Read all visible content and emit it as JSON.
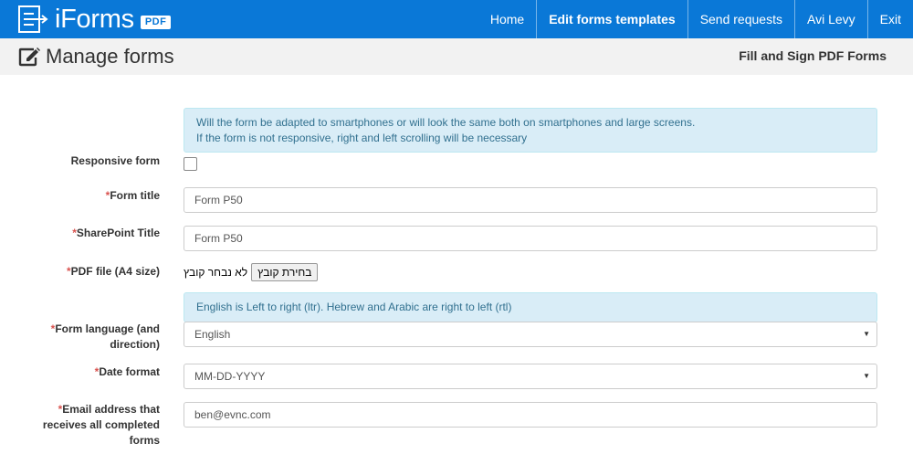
{
  "brand": {
    "name": "iForms",
    "badge": "PDF",
    "logo_icon": "form-arrow-icon"
  },
  "nav": {
    "items": [
      {
        "label": "Home"
      },
      {
        "label": "Edit forms templates"
      },
      {
        "label": "Send requests"
      },
      {
        "label": "Avi Levy"
      },
      {
        "label": "Exit"
      }
    ]
  },
  "header": {
    "icon": "edit-icon",
    "title": "Manage forms",
    "subtitle": "Fill and Sign PDF Forms"
  },
  "form": {
    "responsive_info": {
      "line1": "Will the form be adapted to smartphones or will look the same both on smartphones and large screens.",
      "line2": "If the form is not responsive, right and left scrolling will be necessary"
    },
    "responsive": {
      "label": "Responsive form",
      "checked": false
    },
    "form_title": {
      "required_mark": "*",
      "label": "Form title",
      "value": "Form P50"
    },
    "sharepoint_title": {
      "required_mark": "*",
      "label": "SharePoint Title",
      "value": "Form P50"
    },
    "pdf_file": {
      "required_mark": "*",
      "label": "PDF file (A4 size)",
      "button_label": "בחירת קובץ",
      "status": "לא נבחר קובץ"
    },
    "language_info": "English is Left to right (ltr). Hebrew and Arabic are right to left (rtl)",
    "form_language": {
      "required_mark": "*",
      "label_line1": "Form language (and",
      "label_line2": "direction)",
      "selected": "English"
    },
    "date_format": {
      "required_mark": "*",
      "label": "Date format",
      "selected": "MM-DD-YYYY"
    },
    "email": {
      "required_mark": "*",
      "label_line1": "Email address that",
      "label_line2": "receives all completed",
      "label_line3": "forms",
      "value": "ben@evnc.com"
    }
  },
  "colors": {
    "primary": "#0a78d7",
    "info_bg": "#d9edf7",
    "info_text": "#31708f",
    "required": "#d9534f"
  }
}
